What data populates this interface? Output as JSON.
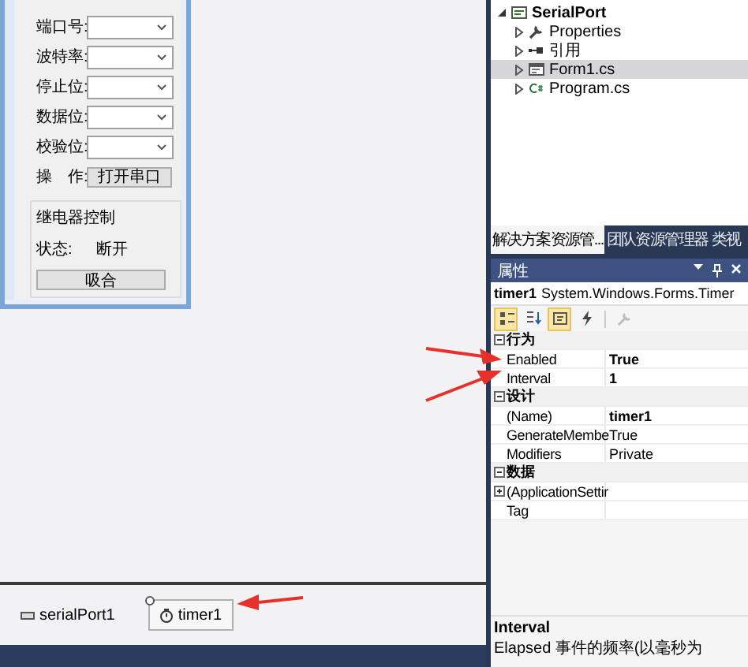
{
  "designer": {
    "form": {
      "fields": [
        {
          "label": "端口号:"
        },
        {
          "label": "波特率:"
        },
        {
          "label": "停止位:"
        },
        {
          "label": "数据位:"
        },
        {
          "label": "校验位:"
        }
      ],
      "operate": {
        "label": "操　作:",
        "button": "打开串口"
      },
      "group": {
        "title": "继电器控制",
        "status_label": "状态:",
        "status_value": "断开",
        "button": "吸合"
      }
    },
    "tray": [
      {
        "name": "serialPort1",
        "kind": "port",
        "selected": false
      },
      {
        "name": "timer1",
        "kind": "timer",
        "selected": true
      }
    ]
  },
  "solution_explorer": {
    "items": [
      {
        "label": "SerialPort",
        "kind": "project",
        "expanded": true,
        "selected": false,
        "children": [
          {
            "label": "Properties",
            "kind": "properties",
            "expanded": false,
            "selected": false
          },
          {
            "label": "引用",
            "kind": "references",
            "expanded": false,
            "selected": false
          },
          {
            "label": "Form1.cs",
            "kind": "form",
            "expanded": false,
            "selected": true
          },
          {
            "label": "Program.cs",
            "kind": "code",
            "expanded": false,
            "selected": false
          }
        ]
      }
    ],
    "tabs": [
      {
        "label": "解决方案资源管...",
        "selected": true
      },
      {
        "label": "团队资源管理器",
        "selected": false
      },
      {
        "label": "类视",
        "selected": false
      }
    ]
  },
  "properties": {
    "title": "属性",
    "object_name": "timer1",
    "object_type": "System.Windows.Forms.Timer",
    "toolbar": [
      {
        "kind": "categorized",
        "selected": true
      },
      {
        "kind": "alphabetical",
        "selected": false
      },
      {
        "kind": "properties",
        "selected": true
      },
      {
        "kind": "events",
        "selected": false
      },
      {
        "kind": "pages",
        "selected": false
      }
    ],
    "categories": [
      {
        "name": "行为",
        "expanded": true,
        "rows": [
          {
            "name": "Enabled",
            "value": "True",
            "modified": true,
            "has_children": false
          },
          {
            "name": "Interval",
            "value": "1",
            "modified": true,
            "has_children": false
          }
        ]
      },
      {
        "name": "设计",
        "expanded": true,
        "rows": [
          {
            "name": "(Name)",
            "value": "timer1",
            "modified": true,
            "has_children": false
          },
          {
            "name": "GenerateMembe",
            "value": "True",
            "modified": false,
            "has_children": false
          },
          {
            "name": "Modifiers",
            "value": "Private",
            "modified": false,
            "has_children": false
          }
        ]
      },
      {
        "name": "数据",
        "expanded": true,
        "rows": [
          {
            "name": "(ApplicationSettir",
            "has_children": true
          },
          {
            "name": "Tag",
            "has_children": false
          }
        ]
      }
    ],
    "description": {
      "title": "Interval",
      "text": "Elapsed 事件的频率(以毫秒为"
    }
  }
}
